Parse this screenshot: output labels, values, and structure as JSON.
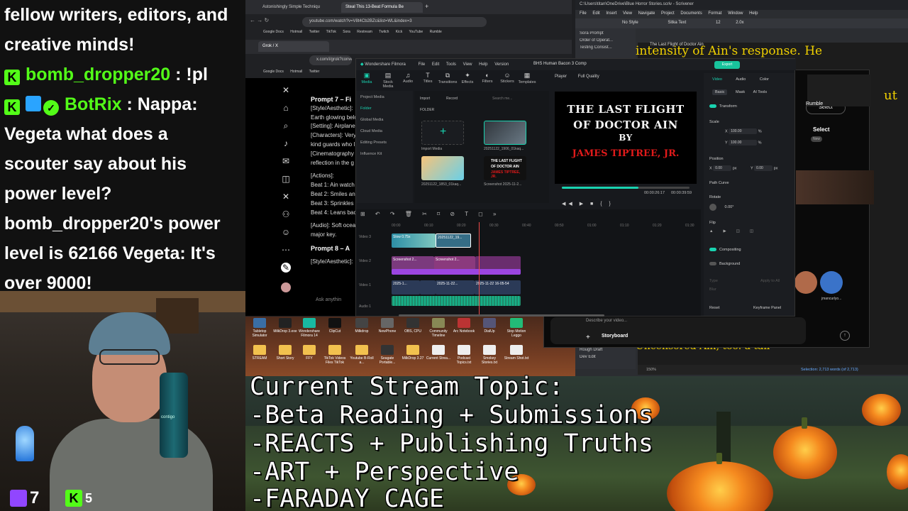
{
  "chat": {
    "messages": [
      {
        "user": "",
        "text": "fellow writers, editors, and"
      },
      {
        "user": "",
        "text": "creative minds!"
      },
      {
        "user": "bomb_dropper20",
        "text": ": !pl"
      },
      {
        "user": "BotRix",
        "text": ": Nappa:"
      },
      {
        "user": "",
        "text": "Vegeta what does a"
      },
      {
        "user": "",
        "text": "scouter say about his"
      },
      {
        "user": "",
        "text": "power level?"
      },
      {
        "user": "",
        "text": "bomb_dropper20's power"
      },
      {
        "user": "",
        "text": "level is 62166 Vegeta: It's"
      },
      {
        "user": "",
        "text": "over 9000!"
      }
    ]
  },
  "webcam": {
    "twitch_viewers": "7",
    "kick_viewers": "5",
    "bottle_label": "contigo"
  },
  "browser": {
    "tabs": [
      "Astonishingly Simple Techniqu",
      "Steal This 13-Beat Formula Be"
    ],
    "url": "youtube.com/watch?v=V8t4Cb2BZc&list=WL&index=3",
    "bookmarks": [
      "Google Docs",
      "Hotmail",
      "Twitter",
      "TikTok",
      "Sora",
      "Restream",
      "Twitch",
      "Kick",
      "YouTube",
      "Rumble"
    ],
    "second_tab": "Grok / X",
    "second_url": "x.com/i/grok?conve",
    "second_bookmarks": [
      "Google Docs",
      "Hotmail",
      "Twitter"
    ]
  },
  "grok": {
    "lines": [
      {
        "bold": true,
        "text": "Prompt 7 – Fi"
      },
      {
        "bold": false,
        "text": "[Style/Aesthetic]:"
      },
      {
        "bold": false,
        "text": "Earth glowing belo"
      },
      {
        "bold": false,
        "text": "[Setting]: Airplane"
      },
      {
        "bold": false,
        "text": "[Characters]: Very"
      },
      {
        "bold": false,
        "text": "kind guards who l"
      },
      {
        "bold": false,
        "text": "[Cinematography"
      },
      {
        "bold": false,
        "text": "reflection in the g"
      },
      {
        "bold": false,
        "text": ""
      },
      {
        "bold": false,
        "text": "[Actions]:"
      },
      {
        "bold": false,
        "text": "Beat 1: Ain watch"
      },
      {
        "bold": false,
        "text": "Beat 2: Smiles an"
      },
      {
        "bold": false,
        "text": "Beat 3: Sprinkles"
      },
      {
        "bold": false,
        "text": "Beat 4: Leans bac"
      },
      {
        "bold": false,
        "text": ""
      },
      {
        "bold": false,
        "text": "[Audio]: Soft ocea"
      },
      {
        "bold": false,
        "text": "major key."
      },
      {
        "bold": false,
        "text": ""
      },
      {
        "bold": true,
        "text": "Prompt 8 – A"
      },
      {
        "bold": false,
        "text": ""
      },
      {
        "bold": false,
        "text": "[Style/Aesthetic]:"
      }
    ],
    "ask_placeholder": "Ask anythin"
  },
  "filmora": {
    "app_name": "Wondershare Filmora",
    "menus": [
      "File",
      "Edit",
      "Tools",
      "View",
      "Help",
      "Version"
    ],
    "project_title": "BHS Human Bacon 3 Comp",
    "export_label": "Export",
    "toolbar": [
      {
        "label": "Media",
        "icon": "media-icon",
        "active": true
      },
      {
        "label": "Stock Media",
        "icon": "stock-media-icon",
        "active": false
      },
      {
        "label": "Audio",
        "icon": "audio-icon",
        "active": false
      },
      {
        "label": "Titles",
        "icon": "titles-icon",
        "active": false
      },
      {
        "label": "Transitions",
        "icon": "transitions-icon",
        "active": false
      },
      {
        "label": "Effects",
        "icon": "effects-icon",
        "active": false
      },
      {
        "label": "Filters",
        "icon": "filters-icon",
        "active": false
      },
      {
        "label": "Stickers",
        "icon": "stickers-icon",
        "active": false
      },
      {
        "label": "Templates",
        "icon": "templates-icon",
        "active": false
      }
    ],
    "left_panel": [
      "Project Media",
      "Folder",
      "Global Media",
      "Cloud Media",
      "Editing Presets",
      "Influence Kit"
    ],
    "media_controls": {
      "import": "Import",
      "record": "Record",
      "search": "Search me...",
      "folder": "FOLDER"
    },
    "media_items": [
      "Import Media",
      "20251122_1906_01kaq...",
      "20251122_1853_01kaq...",
      "Screenshot 2025-11-2..."
    ],
    "player": {
      "label": "Player",
      "quality": "Full Quality",
      "title_lines": [
        "THE LAST FLIGHT",
        "OF DOCTOR AIN",
        "BY",
        "JAMES TIPTREE, JR."
      ],
      "current_time": "00:00:26:17",
      "total_time": "00:00:39:59",
      "progress": 0.6
    },
    "right_panel": {
      "tabs": [
        "Video",
        "Audio",
        "Color"
      ],
      "subtabs": [
        "Basic",
        "Mask",
        "AI Tools"
      ],
      "transform": "Transform",
      "scale": "Scale",
      "scale_x": "100.00",
      "scale_y": "100.00",
      "position": "Position",
      "pos_x": "0.00",
      "pos_y": "0.00",
      "path_curve": "Path Curve",
      "rotate": "Rotate",
      "rotate_val": "0.00°",
      "flip": "Flip",
      "compositing": "Compositing",
      "background": "Background",
      "type": "Type",
      "blur": "Blur",
      "apply_all": "Apply to All",
      "reset": "Reset",
      "keyframe": "Keyframe Panel"
    },
    "timeline": {
      "ruler": [
        "00:00",
        "00:10",
        "00:20",
        "00:30",
        "00:40",
        "00:50",
        "01:00",
        "01:10",
        "01:20",
        "01:30"
      ],
      "tracks": [
        "Video 3",
        "Video 2",
        "Video 1",
        "Audio 1"
      ],
      "clips": [
        "Slow 0.75x",
        "Slow 0.66x",
        "20251122_19...",
        "Screenshot 2...",
        "Screenshot 2...",
        "2025-1...",
        "2025-11-22...",
        "2025-11-22 16-05-54"
      ]
    }
  },
  "scrivener": {
    "title": "C:\\Users\\titan\\OneDrive\\Blue Horror Stories.scriv - Scrivener",
    "menus": [
      "File",
      "Edit",
      "Insert",
      "View",
      "Navigate",
      "Project",
      "Documents",
      "Format",
      "Window",
      "Help"
    ],
    "style": "No Style",
    "font": "Sitka Text",
    "size": "12",
    "spacing": "2.0x",
    "binder": [
      "Sora Prompt",
      "Order of Operat...",
      "Testing Consist..."
    ],
    "binder_bottom": [
      "Rough Draft",
      "Dev Edit"
    ],
    "doc_title": "The Last Flight of Doctor Ain",
    "body_top": "intensity of Ain's response. He",
    "body_bottom": "Uncensored Ain, too. a tail",
    "zoom": "150%",
    "selection": "Selection: 2,713 words (of 2,713)"
  },
  "imagine": {
    "select_label": "Select",
    "new_label": "New",
    "rumble": "Rumble",
    "describe_placeholder": "Describe your video...",
    "storyboard_label": "Storyboard",
    "avatar_name": "jmancurlyo...",
    "right_text": "ut"
  },
  "desktop": {
    "icons_row1": [
      "Tabletop Simulator",
      "MilkDrop 3.exe",
      "Wondershare Filmora 14",
      "ClipCut",
      "Milkdrop",
      "NewPhone",
      "OBS, CPU",
      "Community Timeline",
      "Arc Notebook",
      "DialUp",
      "Stop Motion Leggo"
    ],
    "icons_row2": [
      "STREAM",
      "Short Story",
      "FFY",
      "TikTok Videos Files TikTok",
      "Youtube B-Roll a...",
      "Seagate Portable...",
      "MilkDrop 3.27",
      "Current Strea...",
      "Podcast Topics.txt",
      "Smokey Stories.txt",
      "Stream Shot.txt"
    ]
  },
  "topic": {
    "lines": [
      "Current Stream Topic:",
      "-Beta Reading + Submissions",
      "-REACTS + Publishing Truths",
      "-ART + Perspective",
      "-FARADAY CAGE"
    ]
  }
}
